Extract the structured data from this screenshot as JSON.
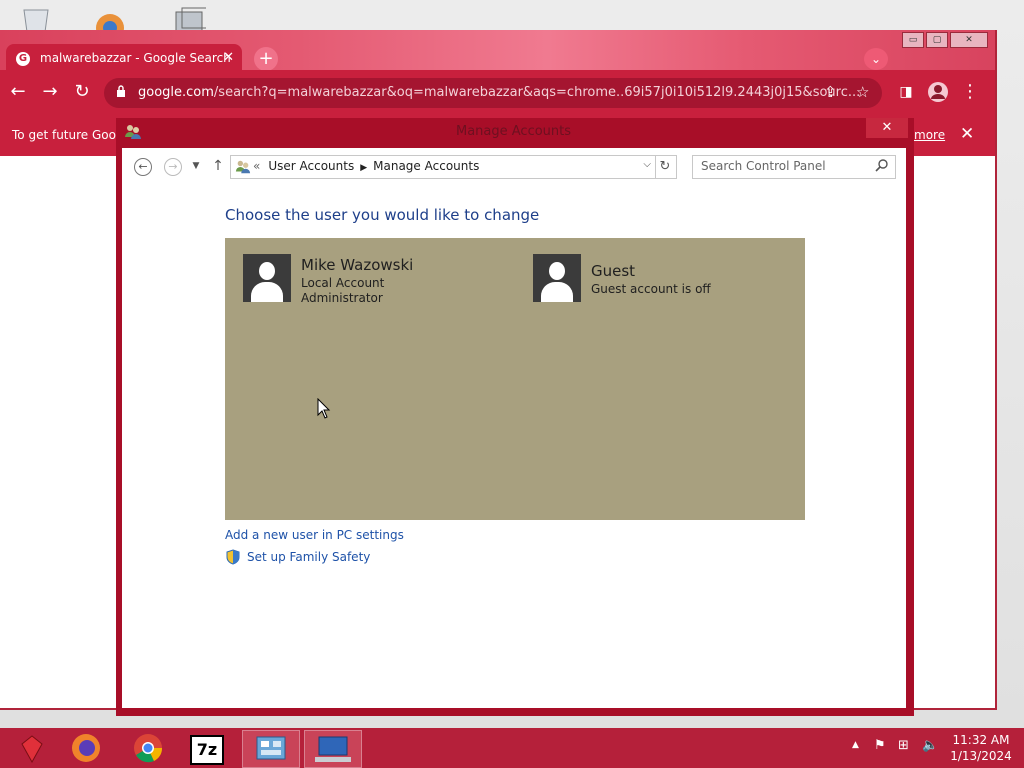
{
  "chrome": {
    "tab_title": "malwarebazzar - Google Search",
    "url_host": "google.com",
    "url_rest": "/search?q=malwarebazzar&oq=malwarebazzar&aqs=chrome..69i57j0i10i512l9.2443j0j15&sourc...",
    "infobar_text": "To get future Goo",
    "infobar_link": "more"
  },
  "control_panel": {
    "window_title": "Manage Accounts",
    "breadcrumb_sep": "«",
    "breadcrumb_1": "User Accounts",
    "breadcrumb_2": "Manage Accounts",
    "search_placeholder": "Search Control Panel",
    "heading": "Choose the user you would like to change",
    "accounts": [
      {
        "name": "Mike Wazowski",
        "line1": "Local Account",
        "line2": "Administrator"
      },
      {
        "name": "Guest",
        "line1": "Guest account is off",
        "line2": ""
      }
    ],
    "add_user_link": "Add a new user in PC settings",
    "family_safety_link": "Set up Family Safety"
  },
  "taskbar": {
    "time": "11:32 AM",
    "date": "1/13/2024",
    "apps": [
      "ruby-icon",
      "firefox-icon",
      "chrome-icon",
      "7zip-icon",
      "control-panel-icon",
      "remote-desktop-icon"
    ]
  },
  "colors": {
    "accent": "#c8203d",
    "accounts_bg": "#a8a07f",
    "link": "#1e52a8"
  }
}
